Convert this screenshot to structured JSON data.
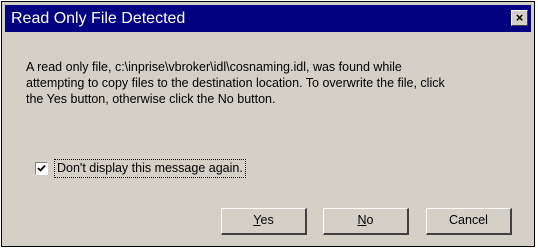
{
  "window": {
    "title": "Read Only File Detected",
    "close_glyph": "×"
  },
  "message": {
    "lines": [
      "A read only file, c:\\inprise\\vbroker\\idl\\cosnaming.idl, was found while",
      "attempting to copy files to the destination location. To overwrite the file, click",
      "the Yes button,  otherwise click the No button."
    ]
  },
  "dont_show": {
    "label": "Don't display this message again.",
    "checked": true
  },
  "buttons": {
    "yes": {
      "mnemonic": "Y",
      "rest": "es"
    },
    "no": {
      "mnemonic": "N",
      "rest": "o"
    },
    "cancel": {
      "label": "Cancel"
    }
  },
  "colors": {
    "title_bar": "#000080",
    "dialog_face": "#d4d0c8",
    "title_text": "#ffffff"
  },
  "icons": {
    "close": "close-icon",
    "check": "checkmark-icon"
  }
}
